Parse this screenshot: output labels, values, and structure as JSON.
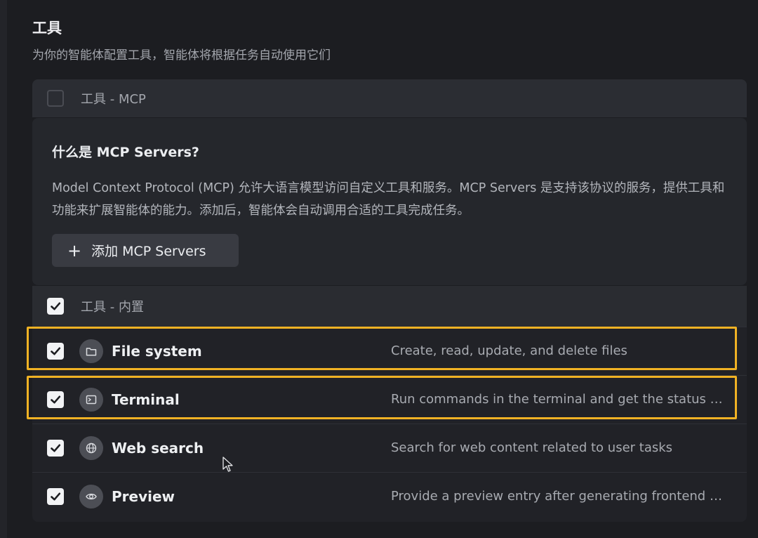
{
  "section": {
    "title": "工具",
    "description": "为你的智能体配置工具，智能体将根据任务自动使用它们"
  },
  "mcp": {
    "group_label": "工具 - MCP",
    "group_checked": false,
    "card_title": "什么是 MCP Servers?",
    "card_body": "Model Context Protocol (MCP) 允许大语言模型访问自定义工具和服务。MCP Servers 是支持该协议的服务，提供工具和功能来扩展智能体的能力。添加后，智能体会自动调用合适的工具完成任务。",
    "add_button": {
      "plus": "+",
      "label": "添加 MCP Servers"
    }
  },
  "builtin": {
    "group_label": "工具 - 内置",
    "group_checked": true,
    "tools": [
      {
        "name": "File system",
        "description": "Create, read, update, and delete files",
        "icon": "folder-icon",
        "checked": true,
        "highlighted": true
      },
      {
        "name": "Terminal",
        "description": "Run commands in the terminal and get the status and result",
        "icon": "terminal-icon",
        "checked": true,
        "highlighted": true
      },
      {
        "name": "Web search",
        "description": "Search for web content related to user tasks",
        "icon": "globe-icon",
        "checked": true,
        "highlighted": false
      },
      {
        "name": "Preview",
        "description": "Provide a preview entry after generating frontend pages",
        "icon": "eye-icon",
        "checked": true,
        "highlighted": false
      }
    ]
  },
  "colors": {
    "highlight": "#f0b224",
    "background": "#1c1d21",
    "panel": "#25272c"
  }
}
